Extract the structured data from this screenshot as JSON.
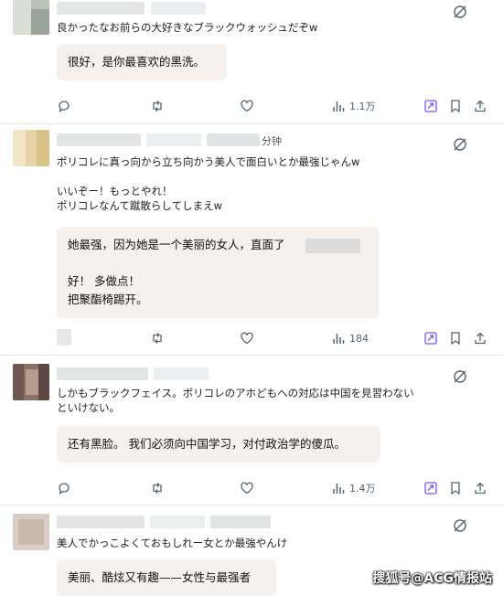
{
  "posts": [
    {
      "original": "良かったなお前らの大好きなブラックウォッシュだぞw",
      "translation": "很好，是你最喜欢的黑洗。",
      "views": "1.1万"
    },
    {
      "header_suffix": "分钟",
      "original": "ポリコレに真っ向から立ち向かう美人で面白いとか最強じゃんw\n\nいいぞー！もっとやれ！\nポリコレなんて蹴散らしてしまえw",
      "translation": "她最强，因为她是一个美丽的女人，直面了\n\n好！ 多做点！\n把聚酯椅踢开。",
      "views": "184"
    },
    {
      "original": "しかもブラックフェイス。ポリコレのアホどもへの対応は中国を見習わない\nといけない。",
      "translation": "还有黑脸。 我们必须向中国学习，对付政治学的傻瓜。",
      "views": "1.4万"
    },
    {
      "original": "美人でかっこよくておもしれー女とか最強やんけ",
      "translation": "美丽、酷炫又有趣——女性与最强者"
    }
  ],
  "watermark": "搜狐号@ACG情报站",
  "colors": {
    "translation_bg": "#f5f1ef",
    "icon_gray": "#536471",
    "grok_purple": "#7856ff"
  }
}
